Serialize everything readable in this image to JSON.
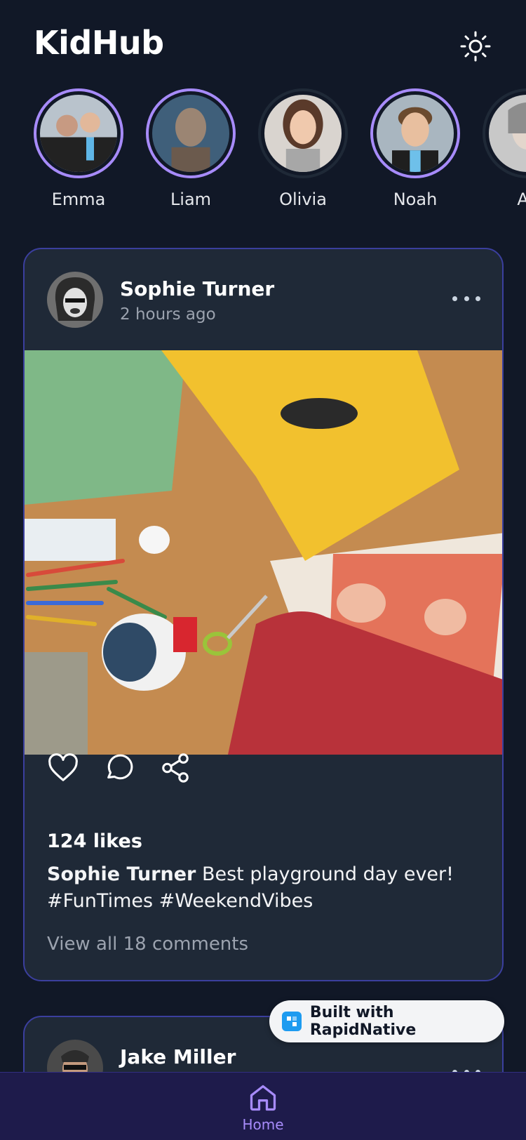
{
  "app": {
    "title": "KidHub"
  },
  "stories": [
    {
      "name": "Emma",
      "seen": false
    },
    {
      "name": "Liam",
      "seen": false
    },
    {
      "name": "Olivia",
      "seen": true
    },
    {
      "name": "Noah",
      "seen": false
    },
    {
      "name": "Av",
      "seen": true
    }
  ],
  "posts": [
    {
      "user": "Sophie Turner",
      "time": "2 hours ago",
      "likes": "124 likes",
      "caption_user": "Sophie Turner",
      "caption_text": "Best playground day ever! #FunTimes #WeekendVibes",
      "comments": "View all 18 comments"
    },
    {
      "user": "Jake Miller"
    }
  ],
  "badge": {
    "label": "Built with RapidNative"
  },
  "nav": {
    "home_label": "Home"
  },
  "colors": {
    "background": "#111827",
    "card": "#1f2937",
    "accent": "#a78bfa",
    "nav": "#1e1b4b"
  }
}
